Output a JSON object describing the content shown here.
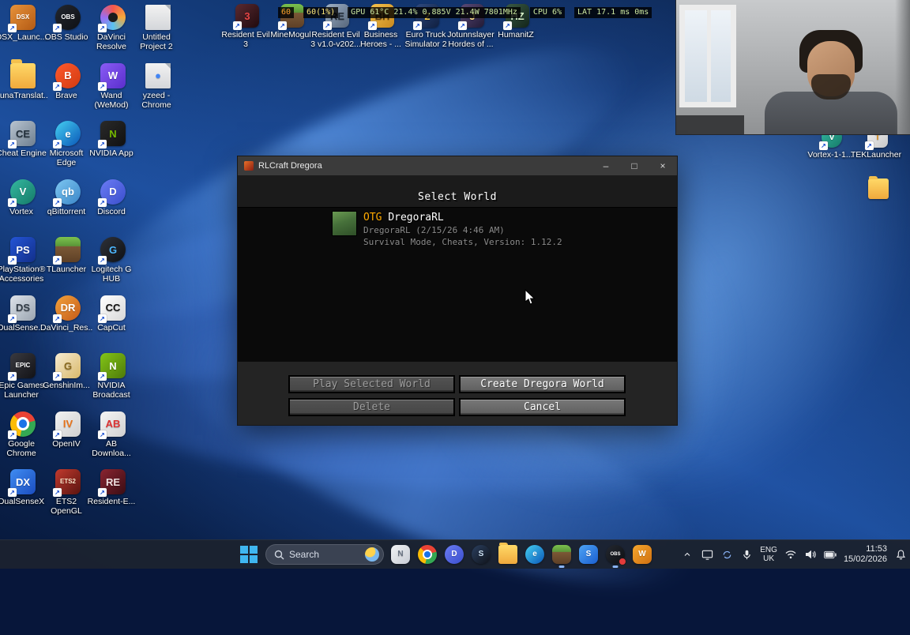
{
  "stats_overlay": {
    "segments": [
      {
        "text": "60",
        "color": "#ff9a2e"
      },
      {
        "text": "60(1%)",
        "color": "#ffe87a"
      },
      {
        "text": "GPU 61°C 21.4% 0.885V 21.4W 7801MHz",
        "color": "#cde8a0"
      },
      {
        "text": "CPU 6%",
        "color": "#cde8a0"
      },
      {
        "text": "LAT 17.1 ms 0ms",
        "color": "#cde8a0"
      }
    ]
  },
  "desktop": {
    "columns": [
      [
        {
          "label": "DSX_Launc...",
          "name": "dsx-launcher",
          "kind": "sq",
          "c1": "#e7923a",
          "c2": "#b35a14",
          "glyph": "DSX",
          "fg": "#fff"
        },
        {
          "label": "LunaTranslat...",
          "name": "lunatranslator",
          "kind": "folder"
        },
        {
          "label": "Cheat Engine",
          "name": "cheat-engine",
          "kind": "sq",
          "c1": "#b9c4d0",
          "c2": "#6e7f90",
          "glyph": "CE",
          "fg": "#23303c"
        },
        {
          "label": "Vortex",
          "name": "vortex",
          "kind": "ci",
          "c1": "#35b8a0",
          "c2": "#157a68",
          "glyph": "V",
          "fg": "#fff"
        },
        {
          "label": "PlayStation® Accessories",
          "name": "playstation-accessories",
          "kind": "sq",
          "c1": "#2455d6",
          "c2": "#122f8a",
          "glyph": "PS",
          "fg": "#fff"
        },
        {
          "label": "DualSense...",
          "name": "dualsense",
          "kind": "sq",
          "c1": "#dde3ea",
          "c2": "#9aa4b0",
          "glyph": "DS",
          "fg": "#333d48"
        },
        {
          "label": "Epic Games Launcher",
          "name": "epic-games-launcher",
          "kind": "sq",
          "c1": "#3a3a40",
          "c2": "#121216",
          "glyph": "EPIC",
          "fg": "#fff"
        },
        {
          "label": "Google Chrome",
          "name": "google-chrome",
          "kind": "chrome"
        },
        {
          "label": "DualSenseX",
          "name": "dualsensex",
          "kind": "sq",
          "c1": "#3f8cf2",
          "c2": "#1b4dbf",
          "glyph": "DX",
          "fg": "#fff"
        }
      ],
      [
        {
          "label": "OBS Studio",
          "name": "obs-studio",
          "kind": "ci",
          "c1": "#23272f",
          "c2": "#0e1014",
          "glyph": "OBS",
          "fg": "#fff"
        },
        {
          "label": "Brave",
          "name": "brave",
          "kind": "ci",
          "c1": "#ff5a2e",
          "c2": "#d13a10",
          "glyph": "B",
          "fg": "#fff"
        },
        {
          "label": "Microsoft Edge",
          "name": "microsoft-edge",
          "kind": "ci",
          "c1": "#45d0f2",
          "c2": "#0a57b8",
          "glyph": "e",
          "fg": "#fff"
        },
        {
          "label": "qBittorrent",
          "name": "qbittorrent",
          "kind": "ci",
          "c1": "#7ec7f2",
          "c2": "#3a86c8",
          "glyph": "qb",
          "fg": "#fff"
        },
        {
          "label": "TLauncher",
          "name": "tlauncher",
          "kind": "grass"
        },
        {
          "label": "DaVinci_Res...",
          "name": "davinci-res",
          "kind": "ci",
          "c1": "#f2a23c",
          "c2": "#c55a18",
          "glyph": "DR",
          "fg": "#fff"
        },
        {
          "label": "GenshinIm...",
          "name": "genshin-impact",
          "kind": "sq",
          "c1": "#f7ecd2",
          "c2": "#d8b86a",
          "glyph": "G",
          "fg": "#8a6a20"
        },
        {
          "label": "OpenIV",
          "name": "openiv",
          "kind": "sq",
          "c1": "#f2f2f2",
          "c2": "#cfcfcf",
          "glyph": "IV",
          "fg": "#e8731a"
        },
        {
          "label": "ETS2 OpenGL",
          "name": "ets2-opengl",
          "kind": "sq",
          "c1": "#c23a2e",
          "c2": "#5a1410",
          "glyph": "ETS2",
          "fg": "#ffe8cc"
        }
      ],
      [
        {
          "label": "DaVinci Resolve",
          "name": "davinci-resolve",
          "kind": "resolve"
        },
        {
          "label": "Wand (WeMod)",
          "name": "wand-wemod",
          "kind": "sq",
          "c1": "#8a5cf5",
          "c2": "#5a2ecc",
          "glyph": "W",
          "fg": "#fff"
        },
        {
          "label": "NVIDIA App",
          "name": "nvidia-app",
          "kind": "sq",
          "c1": "#2a2a2a",
          "c2": "#111111",
          "glyph": "N",
          "fg": "#76b900"
        },
        {
          "label": "Discord",
          "name": "discord",
          "kind": "ci",
          "c1": "#6b7cf5",
          "c2": "#3a4ecc",
          "glyph": "D",
          "fg": "#fff"
        },
        {
          "label": "Logitech G HUB",
          "name": "logitech-g-hub",
          "kind": "ci",
          "c1": "#2e3138",
          "c2": "#0f1115",
          "glyph": "G",
          "fg": "#4db8ff"
        },
        {
          "label": "CapCut",
          "name": "capcut",
          "kind": "sq",
          "c1": "#ffffff",
          "c2": "#d8d8d8",
          "glyph": "CC",
          "fg": "#111"
        },
        {
          "label": "NVIDIA Broadcast",
          "name": "nvidia-broadcast",
          "kind": "sq",
          "c1": "#83c517",
          "c2": "#4e7a0a",
          "glyph": "N",
          "fg": "#fff"
        },
        {
          "label": "AB Downloa...",
          "name": "ab-download",
          "kind": "sq",
          "c1": "#f5f5f5",
          "c2": "#d0d0d0",
          "glyph": "AB",
          "fg": "#d33"
        },
        {
          "label": "Resident-E...",
          "name": "resident-e",
          "kind": "sq",
          "c1": "#8a2430",
          "c2": "#3a0d14",
          "glyph": "RE",
          "fg": "#f0e0e0"
        }
      ],
      [
        {
          "label": "Untitled Project 2",
          "name": "untitled-project-2",
          "kind": "file"
        },
        {
          "label": "yzeed - Chrome",
          "name": "yzeed-chrome",
          "kind": "file",
          "glyph": "●",
          "fg": "#4285f4"
        }
      ]
    ],
    "top_row": [
      {
        "label": "Resident Evil 3",
        "name": "resident-evil-3",
        "kind": "sq",
        "c1": "#5a2a30",
        "c2": "#200a0e",
        "glyph": "3",
        "fg": "#e84545"
      },
      {
        "label": "MineMogul",
        "name": "minemogul",
        "kind": "grass"
      },
      {
        "label": "Resident Evil 3 v1.0-v202...",
        "name": "resident-evil-3-v1",
        "kind": "sq",
        "c1": "#9fb2c8",
        "c2": "#55657a",
        "glyph": "RE",
        "fg": "#222c38"
      },
      {
        "label": "Business Heroes - ...",
        "name": "business-heroes",
        "kind": "sq",
        "c1": "#f5c34e",
        "c2": "#c8881e",
        "glyph": "BH",
        "fg": "#5a3a10"
      },
      {
        "label": "Euro Truck Simulator 2",
        "name": "euro-truck-simulator-2",
        "kind": "sq",
        "c1": "#2e4a80",
        "c2": "#101f40",
        "glyph": "2",
        "fg": "#ffd24d"
      },
      {
        "label": "Jotunnslayer Hordes of ...",
        "name": "jotunnslayer",
        "kind": "sq",
        "c1": "#5a4a78",
        "c2": "#221a35",
        "glyph": "J",
        "fg": "#ffdf8a"
      },
      {
        "label": "HumanitZ",
        "name": "humanitz",
        "kind": "sq",
        "c1": "#3a5a45",
        "c2": "#13251a",
        "glyph": "HZ",
        "fg": "#d8f0c8"
      }
    ],
    "right_items": [
      {
        "label": "Vortex-1-1...",
        "name": "vortex-1-1",
        "kind": "ci",
        "c1": "#35b8a0",
        "c2": "#157a68",
        "glyph": "V",
        "fg": "#fff"
      },
      {
        "label": "TEKLauncher",
        "name": "teklauncher",
        "kind": "sq",
        "c1": "#f2f2f2",
        "c2": "#c8c8c8",
        "glyph": "T",
        "fg": "#d48a1e"
      },
      {
        "label": "",
        "name": "desktop-folder",
        "kind": "folder"
      }
    ]
  },
  "window": {
    "title": "RLCraft Dregora",
    "controls": {
      "minimize": "–",
      "maximize": "□",
      "close": "×"
    },
    "heading": "Select World",
    "world": {
      "prefix": "OTG",
      "name": "DregoraRL",
      "line2": "DregoraRL (2/15/26 4:46 AM)",
      "line3": "Survival Mode, Cheats, Version: 1.12.2"
    },
    "buttons": {
      "play": "Play Selected World",
      "create": "Create Dregora World",
      "delete": "Delete",
      "cancel": "Cancel"
    }
  },
  "taskbar": {
    "search_placeholder": "Search",
    "apps": [
      {
        "name": "notes-app",
        "kind": "sq",
        "c1": "#f0f2f5",
        "c2": "#c8ccd4",
        "glyph": "N",
        "fg": "#667080"
      },
      {
        "name": "chrome",
        "kind": "chrome"
      },
      {
        "name": "discord",
        "kind": "ci",
        "c1": "#6b7cf5",
        "c2": "#3a4ecc",
        "glyph": "D",
        "fg": "#fff"
      },
      {
        "name": "steam",
        "kind": "ci",
        "c1": "#2a3f5f",
        "c2": "#10131a",
        "glyph": "S",
        "fg": "#cfe4f5"
      },
      {
        "name": "file-explorer",
        "kind": "folder"
      },
      {
        "name": "edge",
        "kind": "ci",
        "c1": "#45d0f2",
        "c2": "#0a57b8",
        "glyph": "e",
        "fg": "#fff"
      },
      {
        "name": "rlcraft",
        "kind": "grass",
        "running": true
      },
      {
        "name": "store",
        "kind": "sq",
        "c1": "#4da3f5",
        "c2": "#1a5fd0",
        "glyph": "S",
        "fg": "#fff"
      },
      {
        "name": "obs-recording",
        "kind": "ci",
        "c1": "#23272f",
        "c2": "#0e1014",
        "glyph": "OBS",
        "fg": "#fff",
        "badge": "#e33b3b",
        "running": true
      },
      {
        "name": "gear-app",
        "kind": "sq",
        "c1": "#f5a62e",
        "c2": "#d07010",
        "glyph": "W",
        "fg": "#fff"
      }
    ],
    "tray": {
      "lang1": "ENG",
      "lang2": "UK",
      "time": "11:53",
      "date": "15/02/2026"
    }
  }
}
